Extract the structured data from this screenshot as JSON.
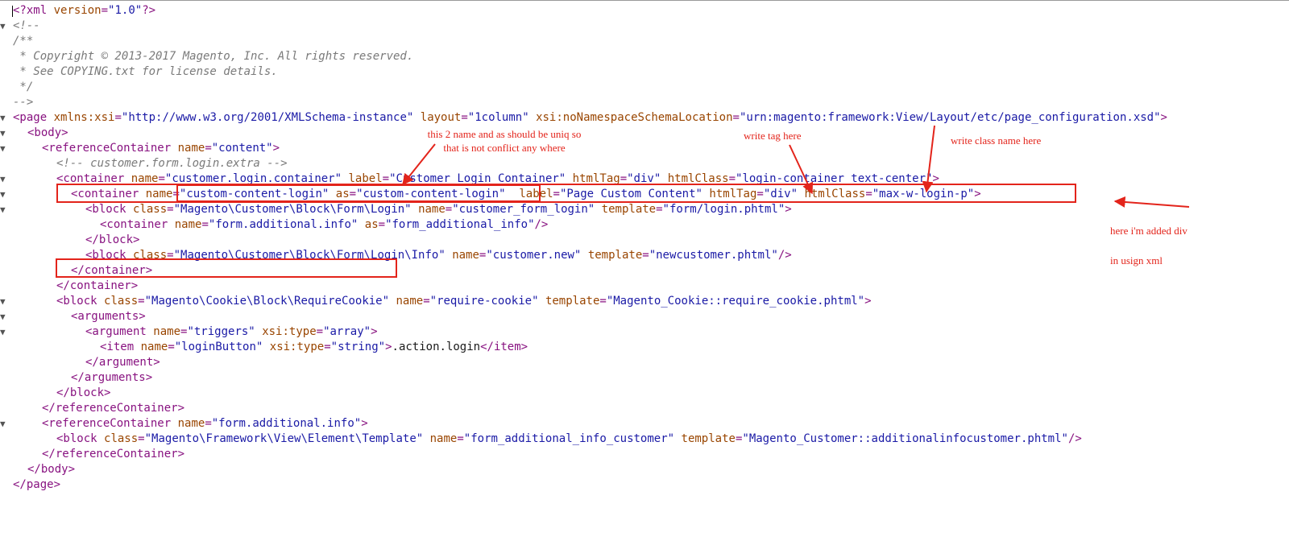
{
  "editor": {
    "lines": [
      {
        "fold": false,
        "caret": true,
        "tokens": [
          {
            "t": "pi",
            "v": "<?xml"
          },
          {
            "t": "text",
            "v": " "
          },
          {
            "t": "attr",
            "v": "version"
          },
          {
            "t": "punc",
            "v": "="
          },
          {
            "t": "val",
            "v": "\"1.0\""
          },
          {
            "t": "pi",
            "v": "?>"
          }
        ]
      },
      {
        "fold": true,
        "tokens": [
          {
            "t": "com",
            "v": "<!--"
          }
        ]
      },
      {
        "fold": false,
        "tokens": [
          {
            "t": "com",
            "v": "/**"
          }
        ]
      },
      {
        "fold": false,
        "tokens": [
          {
            "t": "com",
            "v": " * Copyright © 2013-2017 Magento, Inc. All rights reserved."
          }
        ]
      },
      {
        "fold": false,
        "tokens": [
          {
            "t": "com",
            "v": " * See COPYING.txt for license details."
          }
        ]
      },
      {
        "fold": false,
        "tokens": [
          {
            "t": "com",
            "v": " */"
          }
        ]
      },
      {
        "fold": false,
        "tokens": [
          {
            "t": "com",
            "v": "-->"
          }
        ]
      },
      {
        "fold": true,
        "tokens": [
          {
            "t": "tag",
            "v": "<page"
          },
          {
            "t": "text",
            "v": " "
          },
          {
            "t": "attr",
            "v": "xmlns:xsi"
          },
          {
            "t": "punc",
            "v": "="
          },
          {
            "t": "val",
            "v": "\"http://www.w3.org/2001/XMLSchema-instance\""
          },
          {
            "t": "text",
            "v": " "
          },
          {
            "t": "attr",
            "v": "layout"
          },
          {
            "t": "punc",
            "v": "="
          },
          {
            "t": "val",
            "v": "\"1column\""
          },
          {
            "t": "text",
            "v": " "
          },
          {
            "t": "attr",
            "v": "xsi:noNamespaceSchemaLocation"
          },
          {
            "t": "punc",
            "v": "="
          },
          {
            "t": "val",
            "v": "\"urn:magento:framework:View/Layout/etc/page_configuration.xsd\""
          },
          {
            "t": "tag",
            "v": ">"
          }
        ]
      },
      {
        "fold": true,
        "indent": 1,
        "tokens": [
          {
            "t": "tag",
            "v": "<body>"
          }
        ]
      },
      {
        "fold": true,
        "indent": 2,
        "tokens": [
          {
            "t": "tag",
            "v": "<referenceContainer"
          },
          {
            "t": "text",
            "v": " "
          },
          {
            "t": "attr",
            "v": "name"
          },
          {
            "t": "punc",
            "v": "="
          },
          {
            "t": "val",
            "v": "\"content\""
          },
          {
            "t": "tag",
            "v": ">"
          }
        ]
      },
      {
        "fold": false,
        "indent": 3,
        "tokens": [
          {
            "t": "com",
            "v": "<!-- customer.form.login.extra -->"
          }
        ]
      },
      {
        "fold": true,
        "indent": 3,
        "tokens": [
          {
            "t": "tag",
            "v": "<container"
          },
          {
            "t": "text",
            "v": " "
          },
          {
            "t": "attr",
            "v": "name"
          },
          {
            "t": "punc",
            "v": "="
          },
          {
            "t": "val",
            "v": "\"customer.login.container\""
          },
          {
            "t": "text",
            "v": " "
          },
          {
            "t": "attr",
            "v": "label"
          },
          {
            "t": "punc",
            "v": "="
          },
          {
            "t": "val",
            "v": "\"Customer Login Container\""
          },
          {
            "t": "text",
            "v": " "
          },
          {
            "t": "attr",
            "v": "htmlTag"
          },
          {
            "t": "punc",
            "v": "="
          },
          {
            "t": "val",
            "v": "\"div\""
          },
          {
            "t": "text",
            "v": " "
          },
          {
            "t": "attr",
            "v": "htmlClass"
          },
          {
            "t": "punc",
            "v": "="
          },
          {
            "t": "val",
            "v": "\"login-container text-center\""
          },
          {
            "t": "tag",
            "v": ">"
          }
        ]
      },
      {
        "fold": true,
        "indent": 4,
        "tokens": [
          {
            "t": "tag",
            "v": "<container"
          },
          {
            "t": "text",
            "v": " "
          },
          {
            "t": "attr",
            "v": "name"
          },
          {
            "t": "punc",
            "v": "="
          },
          {
            "t": "val",
            "v": "\"custom-content-login\""
          },
          {
            "t": "text",
            "v": " "
          },
          {
            "t": "attr",
            "v": "as"
          },
          {
            "t": "punc",
            "v": "="
          },
          {
            "t": "val",
            "v": "\"custom-content-login\""
          },
          {
            "t": "text",
            "v": "  "
          },
          {
            "t": "attr",
            "v": "label"
          },
          {
            "t": "punc",
            "v": "="
          },
          {
            "t": "val",
            "v": "\"Page Custom Content\""
          },
          {
            "t": "text",
            "v": " "
          },
          {
            "t": "attr",
            "v": "htmlTag"
          },
          {
            "t": "punc",
            "v": "="
          },
          {
            "t": "val",
            "v": "\"div\""
          },
          {
            "t": "text",
            "v": " "
          },
          {
            "t": "attr",
            "v": "htmlClass"
          },
          {
            "t": "punc",
            "v": "="
          },
          {
            "t": "val",
            "v": "\"max-w-login-p\""
          },
          {
            "t": "tag",
            "v": ">"
          }
        ]
      },
      {
        "fold": true,
        "indent": 5,
        "tokens": [
          {
            "t": "tag",
            "v": "<block"
          },
          {
            "t": "text",
            "v": " "
          },
          {
            "t": "attr",
            "v": "class"
          },
          {
            "t": "punc",
            "v": "="
          },
          {
            "t": "val",
            "v": "\"Magento\\Customer\\Block\\Form\\Login\""
          },
          {
            "t": "text",
            "v": " "
          },
          {
            "t": "attr",
            "v": "name"
          },
          {
            "t": "punc",
            "v": "="
          },
          {
            "t": "val",
            "v": "\"customer_form_login\""
          },
          {
            "t": "text",
            "v": " "
          },
          {
            "t": "attr",
            "v": "template"
          },
          {
            "t": "punc",
            "v": "="
          },
          {
            "t": "val",
            "v": "\"form/login.phtml\""
          },
          {
            "t": "tag",
            "v": ">"
          }
        ]
      },
      {
        "fold": false,
        "indent": 6,
        "tokens": [
          {
            "t": "tag",
            "v": "<container"
          },
          {
            "t": "text",
            "v": " "
          },
          {
            "t": "attr",
            "v": "name"
          },
          {
            "t": "punc",
            "v": "="
          },
          {
            "t": "val",
            "v": "\"form.additional.info\""
          },
          {
            "t": "text",
            "v": " "
          },
          {
            "t": "attr",
            "v": "as"
          },
          {
            "t": "punc",
            "v": "="
          },
          {
            "t": "val",
            "v": "\"form_additional_info\""
          },
          {
            "t": "tag",
            "v": "/>"
          }
        ]
      },
      {
        "fold": false,
        "indent": 5,
        "tokens": [
          {
            "t": "tag",
            "v": "</block>"
          }
        ]
      },
      {
        "fold": false,
        "indent": 5,
        "tokens": [
          {
            "t": "tag",
            "v": "<block"
          },
          {
            "t": "text",
            "v": " "
          },
          {
            "t": "attr",
            "v": "class"
          },
          {
            "t": "punc",
            "v": "="
          },
          {
            "t": "val",
            "v": "\"Magento\\Customer\\Block\\Form\\Login\\Info\""
          },
          {
            "t": "text",
            "v": " "
          },
          {
            "t": "attr",
            "v": "name"
          },
          {
            "t": "punc",
            "v": "="
          },
          {
            "t": "val",
            "v": "\"customer.new\""
          },
          {
            "t": "text",
            "v": " "
          },
          {
            "t": "attr",
            "v": "template"
          },
          {
            "t": "punc",
            "v": "="
          },
          {
            "t": "val",
            "v": "\"newcustomer.phtml\""
          },
          {
            "t": "tag",
            "v": "/>"
          }
        ]
      },
      {
        "fold": false,
        "indent": 4,
        "tokens": [
          {
            "t": "tag",
            "v": "</container>"
          }
        ]
      },
      {
        "fold": false,
        "indent": 3,
        "tokens": [
          {
            "t": "tag",
            "v": "</container>"
          }
        ]
      },
      {
        "fold": true,
        "indent": 3,
        "tokens": [
          {
            "t": "tag",
            "v": "<block"
          },
          {
            "t": "text",
            "v": " "
          },
          {
            "t": "attr",
            "v": "class"
          },
          {
            "t": "punc",
            "v": "="
          },
          {
            "t": "val",
            "v": "\"Magento\\Cookie\\Block\\RequireCookie\""
          },
          {
            "t": "text",
            "v": " "
          },
          {
            "t": "attr",
            "v": "name"
          },
          {
            "t": "punc",
            "v": "="
          },
          {
            "t": "val",
            "v": "\"require-cookie\""
          },
          {
            "t": "text",
            "v": " "
          },
          {
            "t": "attr",
            "v": "template"
          },
          {
            "t": "punc",
            "v": "="
          },
          {
            "t": "val",
            "v": "\"Magento_Cookie::require_cookie.phtml\""
          },
          {
            "t": "tag",
            "v": ">"
          }
        ]
      },
      {
        "fold": true,
        "indent": 4,
        "tokens": [
          {
            "t": "tag",
            "v": "<arguments>"
          }
        ]
      },
      {
        "fold": true,
        "indent": 5,
        "tokens": [
          {
            "t": "tag",
            "v": "<argument"
          },
          {
            "t": "text",
            "v": " "
          },
          {
            "t": "attr",
            "v": "name"
          },
          {
            "t": "punc",
            "v": "="
          },
          {
            "t": "val",
            "v": "\"triggers\""
          },
          {
            "t": "text",
            "v": " "
          },
          {
            "t": "attr",
            "v": "xsi:type"
          },
          {
            "t": "punc",
            "v": "="
          },
          {
            "t": "val",
            "v": "\"array\""
          },
          {
            "t": "tag",
            "v": ">"
          }
        ]
      },
      {
        "fold": false,
        "indent": 6,
        "tokens": [
          {
            "t": "tag",
            "v": "<item"
          },
          {
            "t": "text",
            "v": " "
          },
          {
            "t": "attr",
            "v": "name"
          },
          {
            "t": "punc",
            "v": "="
          },
          {
            "t": "val",
            "v": "\"loginButton\""
          },
          {
            "t": "text",
            "v": " "
          },
          {
            "t": "attr",
            "v": "xsi:type"
          },
          {
            "t": "punc",
            "v": "="
          },
          {
            "t": "val",
            "v": "\"string\""
          },
          {
            "t": "tag",
            "v": ">"
          },
          {
            "t": "text",
            "v": ".action.login"
          },
          {
            "t": "tag",
            "v": "</item>"
          }
        ]
      },
      {
        "fold": false,
        "indent": 5,
        "tokens": [
          {
            "t": "tag",
            "v": "</argument>"
          }
        ]
      },
      {
        "fold": false,
        "indent": 4,
        "tokens": [
          {
            "t": "tag",
            "v": "</arguments>"
          }
        ]
      },
      {
        "fold": false,
        "indent": 3,
        "tokens": [
          {
            "t": "tag",
            "v": "</block>"
          }
        ]
      },
      {
        "fold": false,
        "indent": 2,
        "tokens": [
          {
            "t": "tag",
            "v": "</referenceContainer>"
          }
        ]
      },
      {
        "fold": true,
        "indent": 2,
        "tokens": [
          {
            "t": "tag",
            "v": "<referenceContainer"
          },
          {
            "t": "text",
            "v": " "
          },
          {
            "t": "attr",
            "v": "name"
          },
          {
            "t": "punc",
            "v": "="
          },
          {
            "t": "val",
            "v": "\"form.additional.info\""
          },
          {
            "t": "tag",
            "v": ">"
          }
        ]
      },
      {
        "fold": false,
        "indent": 3,
        "tokens": [
          {
            "t": "tag",
            "v": "<block"
          },
          {
            "t": "text",
            "v": " "
          },
          {
            "t": "attr",
            "v": "class"
          },
          {
            "t": "punc",
            "v": "="
          },
          {
            "t": "val",
            "v": "\"Magento\\Framework\\View\\Element\\Template\""
          },
          {
            "t": "text",
            "v": " "
          },
          {
            "t": "attr",
            "v": "name"
          },
          {
            "t": "punc",
            "v": "="
          },
          {
            "t": "val",
            "v": "\"form_additional_info_customer\""
          },
          {
            "t": "text",
            "v": " "
          },
          {
            "t": "attr",
            "v": "template"
          },
          {
            "t": "punc",
            "v": "="
          },
          {
            "t": "val",
            "v": "\"Magento_Customer::additionalinfocustomer.phtml\""
          },
          {
            "t": "tag",
            "v": "/>"
          }
        ]
      },
      {
        "fold": false,
        "indent": 2,
        "tokens": [
          {
            "t": "tag",
            "v": "</referenceContainer>"
          }
        ]
      },
      {
        "fold": false,
        "indent": 1,
        "tokens": [
          {
            "t": "tag",
            "v": "</body>"
          }
        ]
      },
      {
        "fold": false,
        "indent": 0,
        "tokens": [
          {
            "t": "tag",
            "v": "</page>"
          }
        ]
      }
    ]
  },
  "annotations": {
    "note_name_as_line1": "this 2 name and as should be uniq so",
    "note_name_as_line2": "that is not conflict any where",
    "note_tag": "write tag here",
    "note_class": "write class name here",
    "note_added_div_line1": "here i'm added div",
    "note_added_div_line2": "in usign xml",
    "color": "#e3241b"
  },
  "colors": {
    "tag": "#881280",
    "attribute": "#994500",
    "value": "#1a1aa6",
    "comment": "#7a7a7a",
    "background": "#ffffff"
  }
}
